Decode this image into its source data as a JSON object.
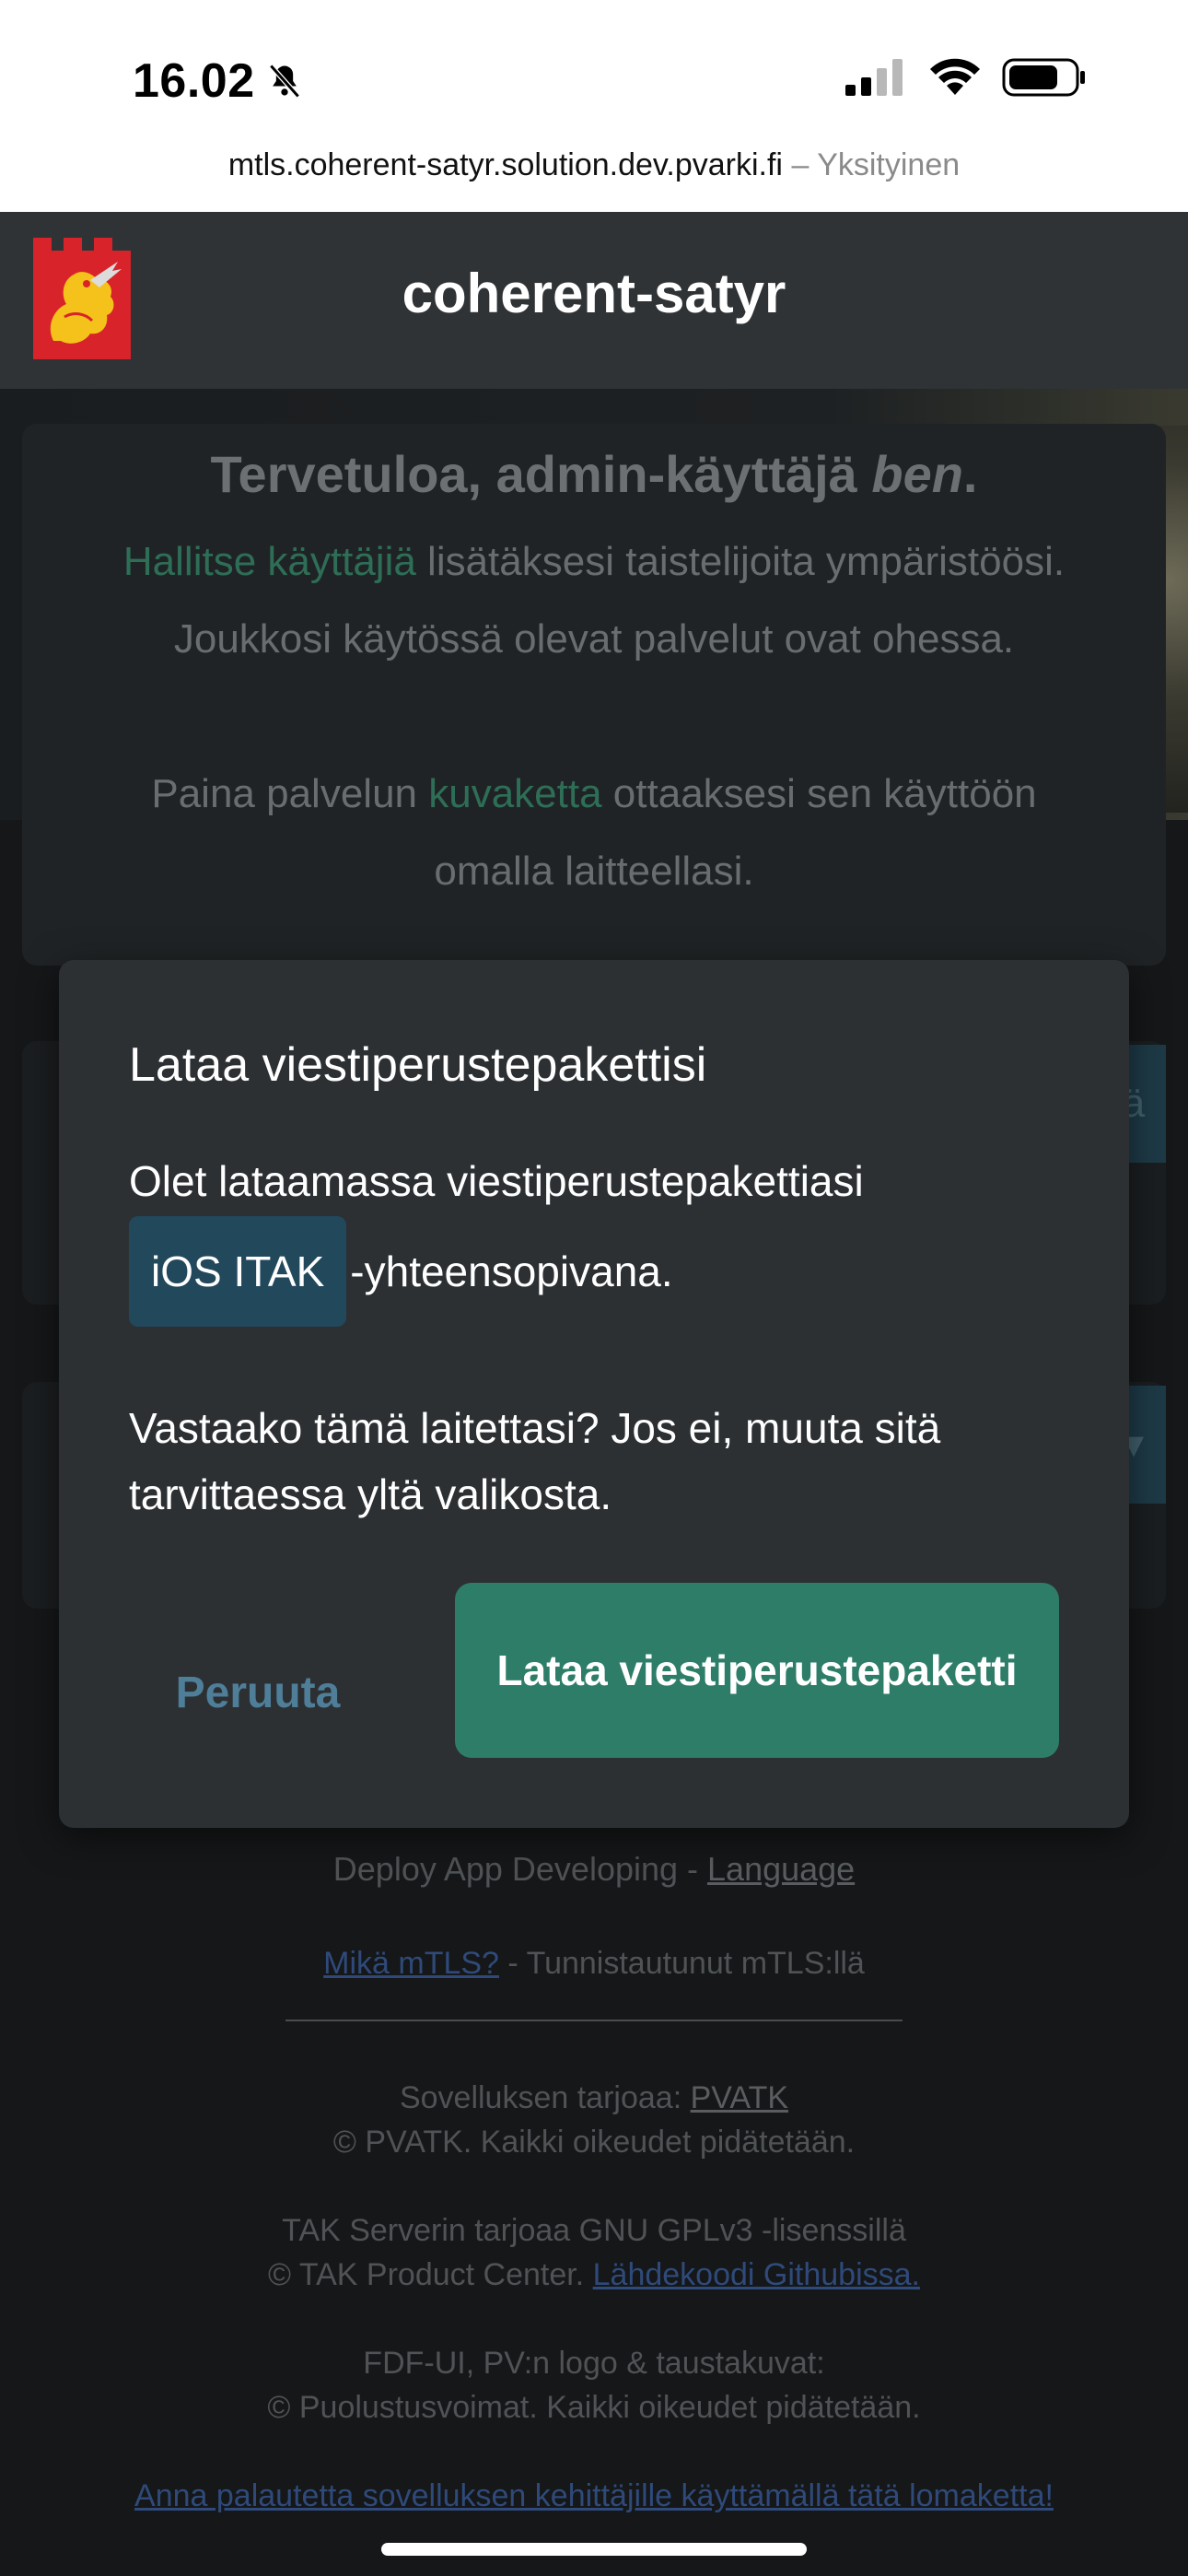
{
  "status_bar": {
    "time": "16.02",
    "icons": [
      "bell-slash-icon",
      "signal-icon",
      "wifi-icon",
      "battery-icon"
    ]
  },
  "url_bar": {
    "domain": "mtls.coherent-satyr.solution.dev.pvarki.fi",
    "separator": "–",
    "mode": "Yksityinen"
  },
  "header": {
    "title": "coherent-satyr",
    "logo": "lion-crest-logo"
  },
  "welcome": {
    "heading_prefix": "Tervetuloa, admin-käyttäjä ",
    "heading_user": "ben",
    "heading_suffix": ".",
    "line1_link": "Hallitse käyttäjiä",
    "line1_rest": " lisätäksesi taistelijoita ympäristöösi.",
    "line2": "Joukkosi käytössä olevat palvelut ovat ohessa.",
    "line3_prefix": "Paina palvelun ",
    "line3_link": "kuvaketta",
    "line3_suffix": " ottaaksesi sen käyttöön",
    "line4": "omalla laitteellasi."
  },
  "modal": {
    "title": "Lataa viestiperustepakettisi",
    "text1": "Olet lataamassa viestiperustepakettiasi",
    "platform": "iOS ITAK",
    "platform_suffix": "-yhteensopivana.",
    "text2": "Vastaako tämä laitettasi? Jos ei, muuta sitä tarvittaessa yltä valikosta.",
    "cancel_label": "Peruuta",
    "download_label": "Lataa viestiperustepaketti"
  },
  "footer": {
    "app_line_prefix": "Deploy App Developing - ",
    "language_link": "Language",
    "mtls_link": "Mikä mTLS?",
    "mtls_rest": " - Tunnistautunut mTLS:llä",
    "provider_prefix": "Sovelluksen tarjoaa: ",
    "provider_link": "PVATK",
    "provider_rights": "© PVATK. Kaikki oikeudet pidätetään.",
    "tak_line1": "TAK Serverin tarjoaa GNU GPLv3 -lisenssillä",
    "tak_line2_prefix": "© TAK Product Center. ",
    "tak_link": "Lähdekoodi Githubissa.",
    "fdf_line1": "FDF-UI, PV:n logo & taustakuvat:",
    "fdf_line2": "© Puolustusvoimat. Kaikki oikeudet pidätetään.",
    "feedback_link": "Anna palautetta sovelluksen kehittäjille käyttämällä tätä lomaketta!"
  }
}
